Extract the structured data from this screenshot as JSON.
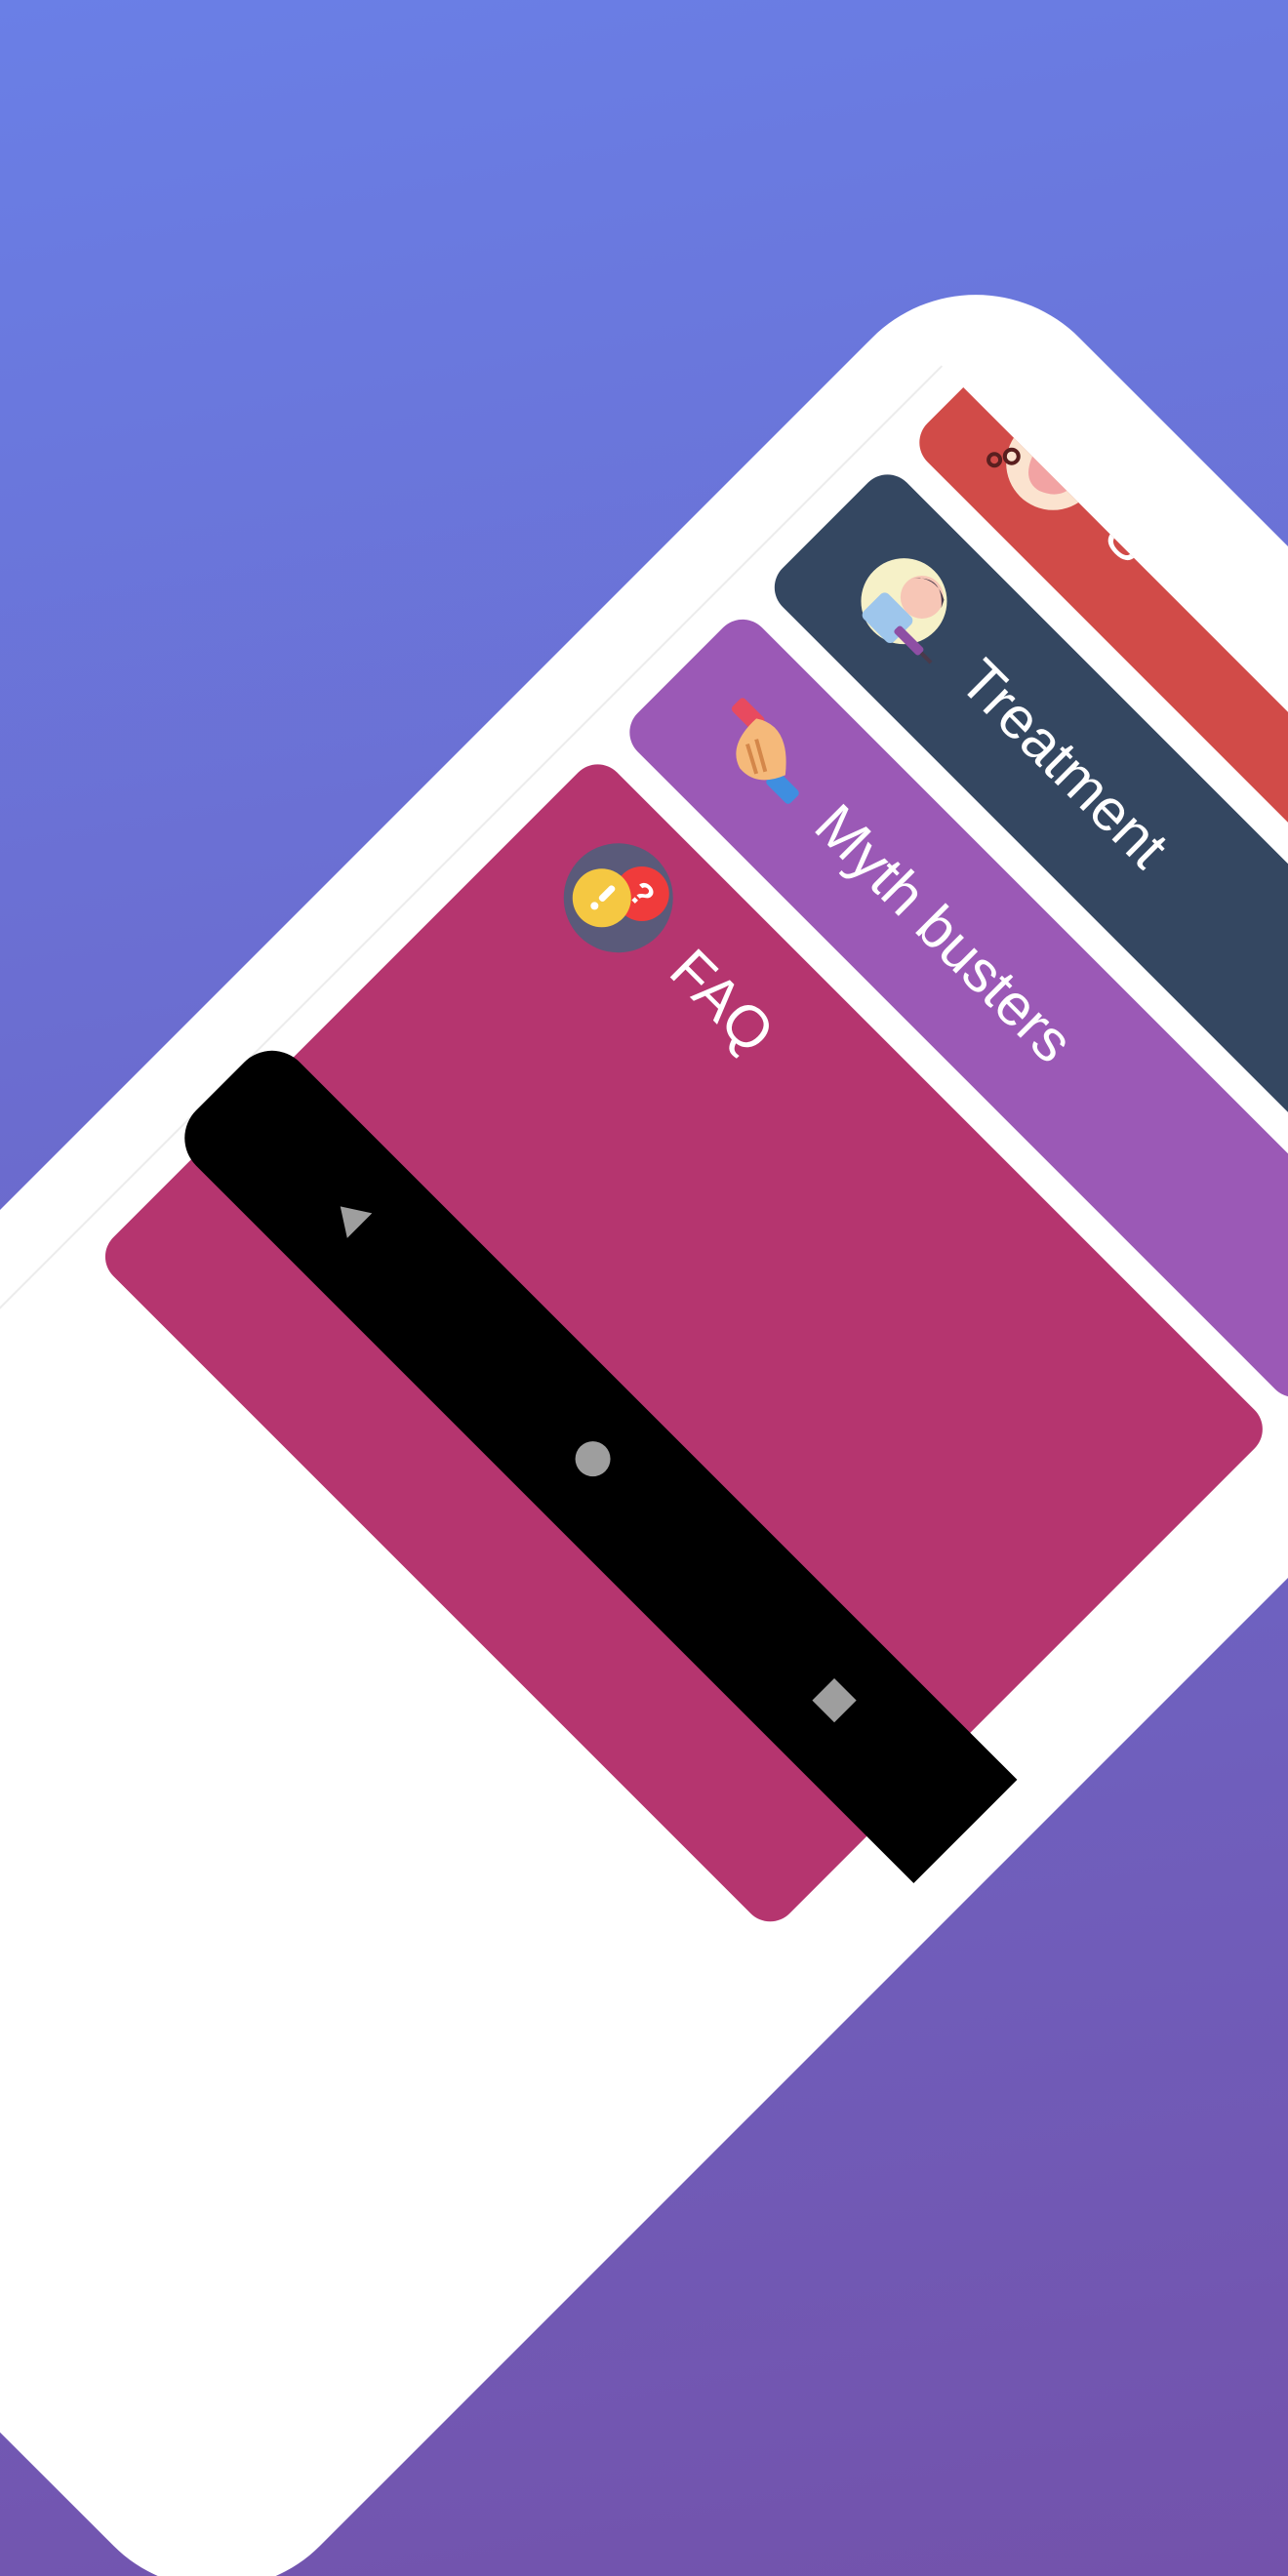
{
  "menu": {
    "items": [
      {
        "label": "",
        "color": "#1fae8e",
        "icon": "partial-green-item"
      },
      {
        "label": "S",
        "color": "#d14b48",
        "icon": "coughing-person-icon"
      },
      {
        "label": "Treatment",
        "color": "#344761",
        "icon": "patient-injection-icon"
      },
      {
        "label": "Myth busters",
        "color": "#9b59b6",
        "icon": "handshake-icon"
      },
      {
        "label": "FAQ",
        "color": "#b5356f",
        "icon": "question-exclamation-bubbles-icon"
      }
    ]
  },
  "nav": {
    "back": "back-triangle-icon",
    "home": "home-circle-icon",
    "recents": "recents-square-icon"
  },
  "colors": {
    "background_top": "#6a7fe6",
    "background_bottom": "#7352ab",
    "phone_body": "#ffffff",
    "nav_bar": "#000000"
  }
}
